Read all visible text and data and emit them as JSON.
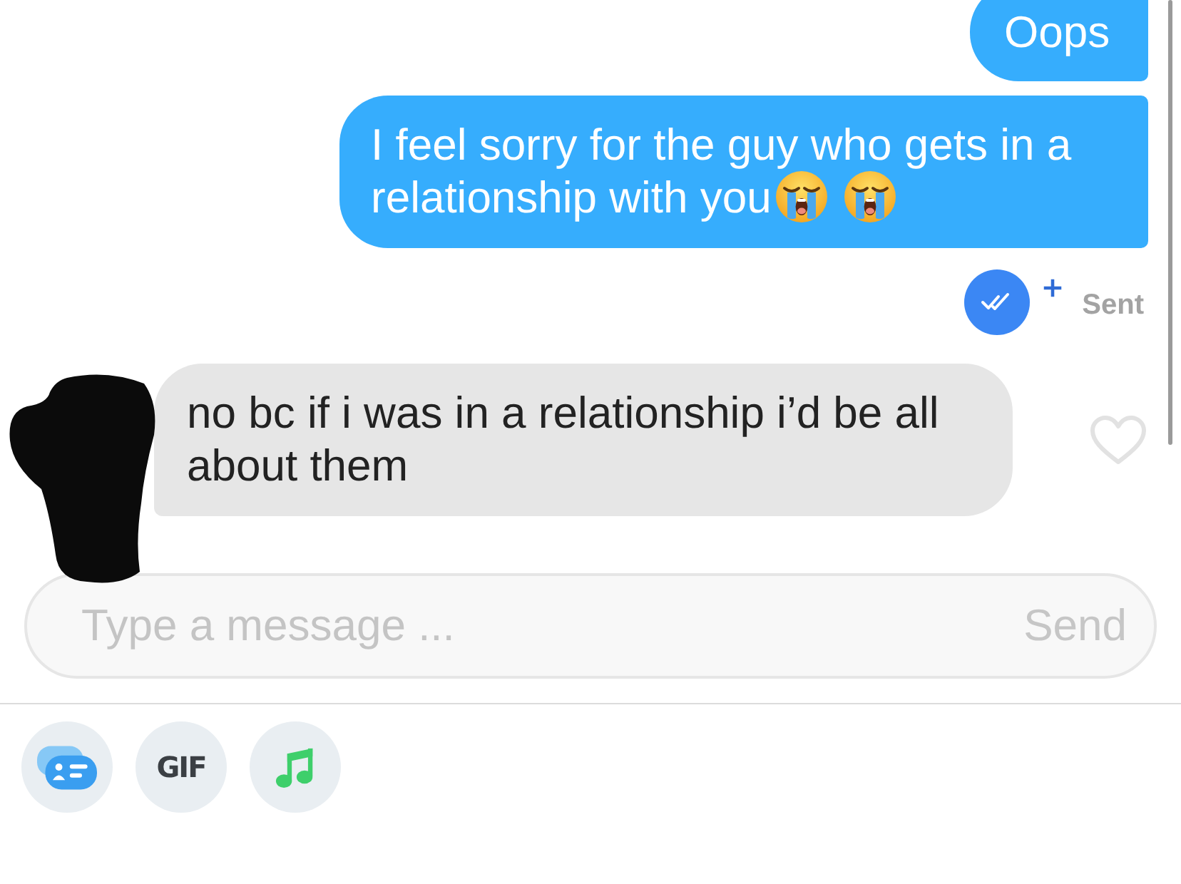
{
  "messages": [
    {
      "kind": "sent",
      "lines": [
        "Oops"
      ]
    },
    {
      "kind": "sent",
      "lines": [
        "I feel sorry for the guy who gets in a",
        "relationship with you"
      ],
      "emojis": [
        {
          "kind": "crying"
        },
        {
          "kind": "crying"
        }
      ],
      "status": "Sent"
    },
    {
      "kind": "received",
      "text": "no bc if i was in a relationship i’d be all about them",
      "liked": false
    }
  ],
  "composer": {
    "placeholder": "Type a message ...",
    "send": {
      "label": "Send",
      "disabled": true
    }
  },
  "attachments": [
    {
      "kind": "sticker"
    },
    {
      "kind": "gif",
      "label": "GIF"
    },
    {
      "kind": "music"
    }
  ]
}
